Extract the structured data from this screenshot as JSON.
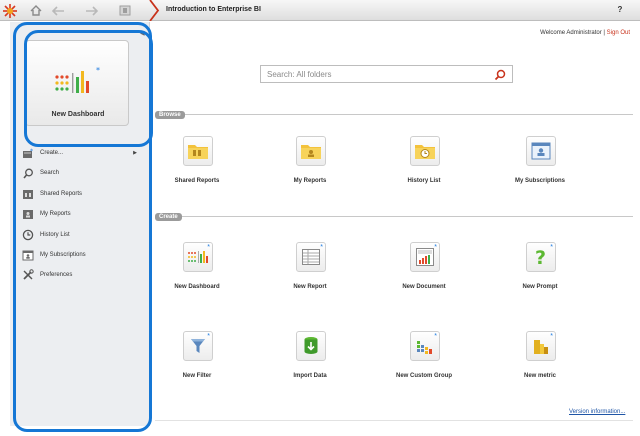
{
  "topbar": {
    "title": "Introduction to Enterprise BI",
    "help": "?"
  },
  "sidebar": {
    "collapse_glyph": "◀",
    "tile_label": "New Dashboard",
    "items": [
      {
        "label": "Create...",
        "icon": "create-icon"
      },
      {
        "label": "Search",
        "icon": "search-icon"
      },
      {
        "label": "Shared Reports",
        "icon": "shared-reports-icon"
      },
      {
        "label": "My Reports",
        "icon": "my-reports-icon"
      },
      {
        "label": "History List",
        "icon": "history-icon"
      },
      {
        "label": "My Subscriptions",
        "icon": "subscriptions-icon"
      },
      {
        "label": "Preferences",
        "icon": "preferences-icon"
      }
    ]
  },
  "header": {
    "welcome": "Welcome Administrator | ",
    "signout": "Sign Out"
  },
  "search": {
    "placeholder": "Search: All folders"
  },
  "browse": {
    "title": "Browse",
    "tiles": [
      {
        "label": "Shared Reports"
      },
      {
        "label": "My Reports"
      },
      {
        "label": "History List"
      },
      {
        "label": "My Subscriptions"
      }
    ]
  },
  "create": {
    "title": "Create",
    "tiles": [
      {
        "label": "New Dashboard"
      },
      {
        "label": "New Report"
      },
      {
        "label": "New Document"
      },
      {
        "label": "New Prompt"
      },
      {
        "label": "New Filter"
      },
      {
        "label": "Import Data"
      },
      {
        "label": "New Custom Group"
      },
      {
        "label": "New metric"
      }
    ]
  },
  "footer": {
    "version": "Version information..."
  },
  "colors": {
    "accent": "#c8321b",
    "highlight": "#1577d5",
    "folder": "#f3c23b"
  }
}
